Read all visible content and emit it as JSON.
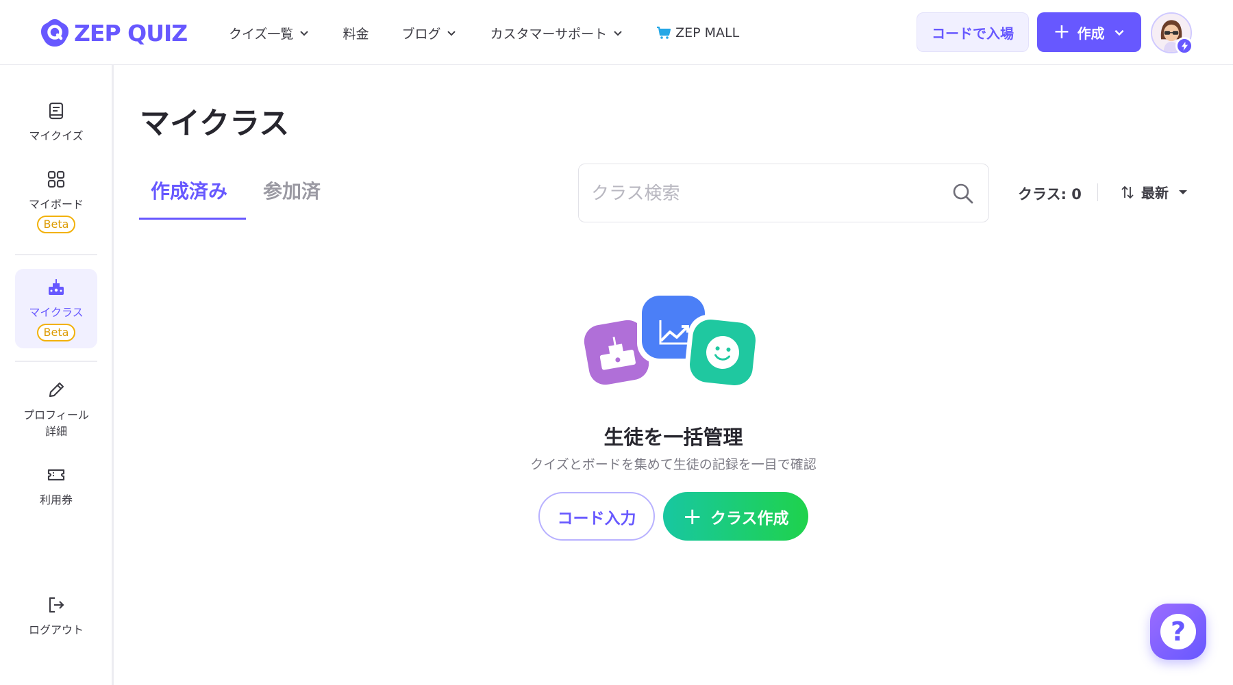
{
  "header": {
    "logo_text": "ZEP QUIZ",
    "nav": [
      {
        "label": "クイズ一覧",
        "dropdown": true
      },
      {
        "label": "料金",
        "dropdown": false
      },
      {
        "label": "ブログ",
        "dropdown": true
      },
      {
        "label": "カスタマーサポート",
        "dropdown": true
      },
      {
        "label": "ZEP MALL",
        "dropdown": false,
        "icon": "cart-icon"
      }
    ],
    "enter_code_label": "コードで入場",
    "create_label": "作成"
  },
  "sidebar": {
    "items": [
      {
        "label": "マイクイズ",
        "icon": "book-icon",
        "beta": ""
      },
      {
        "label": "マイボード",
        "icon": "grid-icon",
        "beta": "Beta"
      },
      {
        "label": "マイクラス",
        "icon": "class-icon",
        "beta": "Beta",
        "active": true
      },
      {
        "label": "プロフィール詳細",
        "label_line1": "プロフィール",
        "label_line2": "詳細",
        "icon": "pencil-icon"
      },
      {
        "label": "利用券",
        "icon": "ticket-icon"
      },
      {
        "label": "ログアウト",
        "icon": "logout-icon"
      }
    ]
  },
  "main": {
    "title": "マイクラス",
    "tabs": [
      {
        "label": "作成済み",
        "active": true
      },
      {
        "label": "参加済",
        "active": false
      }
    ],
    "search": {
      "placeholder": "クラス検索",
      "value": ""
    },
    "class_count": "クラス: 0",
    "sort_label": "最新",
    "empty": {
      "title": "生徒を一括管理",
      "subtitle": "クイズとボードを集めて生徒の記録を一目で確認",
      "code_button": "コード入力",
      "create_button": "クラス作成"
    }
  },
  "colors": {
    "primary": "#6758ff",
    "beta_border": "#f2b10a",
    "create_class_start": "#18c7a1",
    "create_class_end": "#1fd24c"
  }
}
